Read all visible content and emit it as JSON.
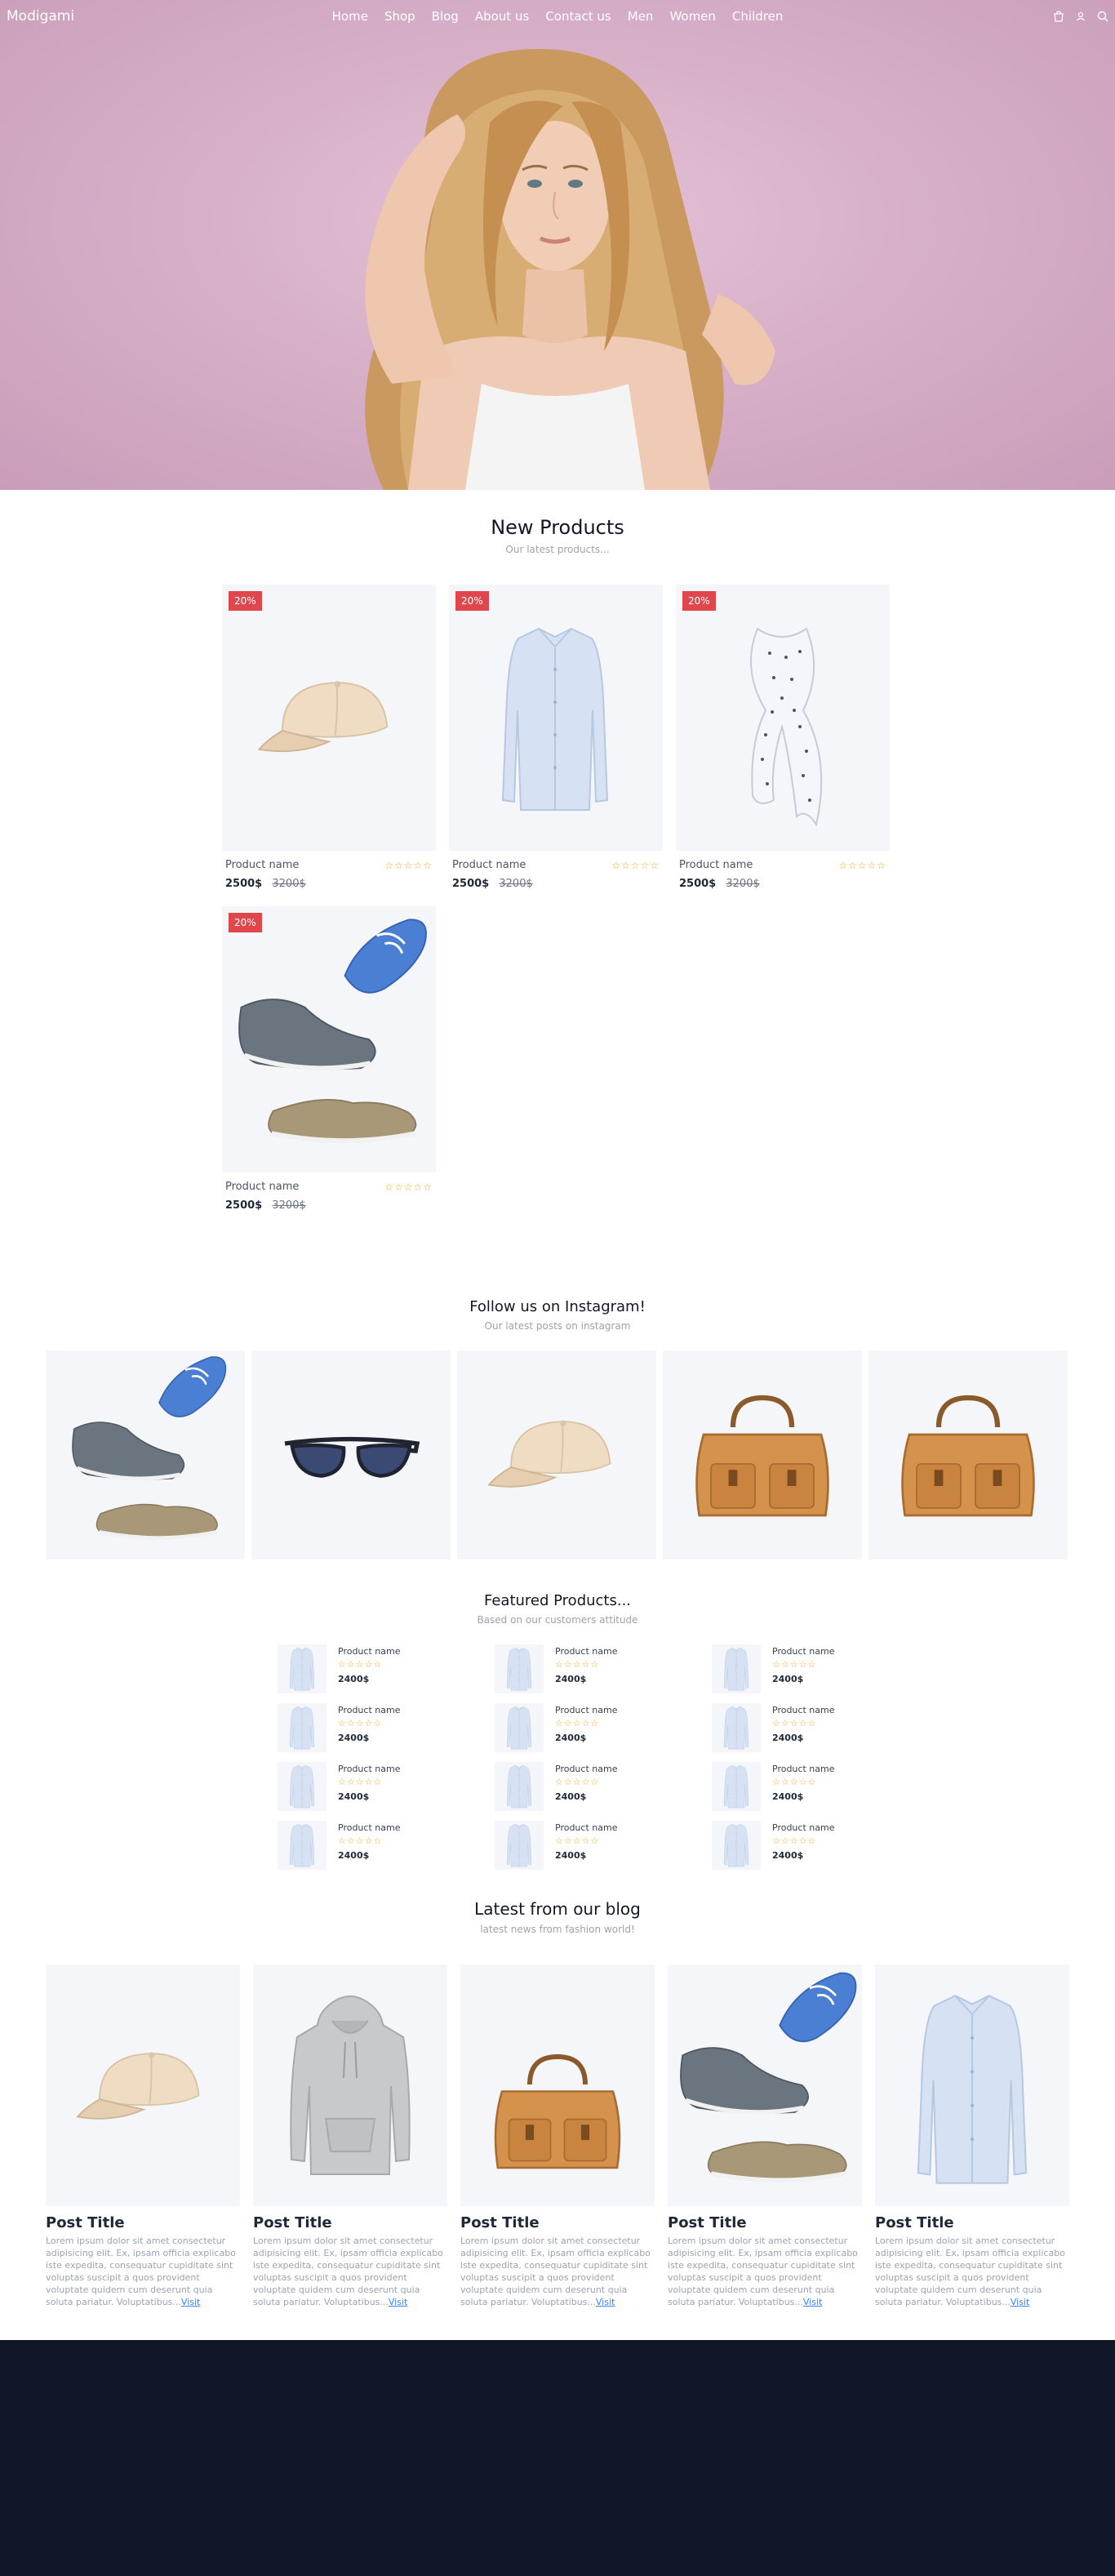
{
  "nav": {
    "logo": "Modigami",
    "links": [
      "Home",
      "Shop",
      "Blog",
      "About us",
      "Contact us",
      "Men",
      "Women",
      "Children"
    ],
    "icons": [
      "bag-icon",
      "user-icon",
      "search-icon"
    ]
  },
  "new_products": {
    "title": "New Products",
    "subtitle": "Our latest products...",
    "items": [
      {
        "badge": "20%",
        "name": "Product name",
        "stars": "☆☆☆☆☆",
        "price": "2500$",
        "old_price": "3200$",
        "image": "cap"
      },
      {
        "badge": "20%",
        "name": "Product name",
        "stars": "☆☆☆☆☆",
        "price": "2500$",
        "old_price": "3200$",
        "image": "shirt"
      },
      {
        "badge": "20%",
        "name": "Product name",
        "stars": "☆☆☆☆☆",
        "price": "2500$",
        "old_price": "3200$",
        "image": "scarf"
      },
      {
        "badge": "20%",
        "name": "Product name",
        "stars": "☆☆☆☆☆",
        "price": "2500$",
        "old_price": "3200$",
        "image": "shoes"
      }
    ]
  },
  "instagram": {
    "title": "Follow us on Instagram!",
    "subtitle": "Our latest posts on instagram",
    "tiles": [
      "shoes",
      "sunglasses",
      "cap",
      "bag",
      "bag"
    ]
  },
  "featured": {
    "title": "Featured Products...",
    "subtitle": "Based on our customers attitude",
    "items": [
      {
        "name": "Product name",
        "stars": "☆☆☆☆☆",
        "price": "2400$"
      },
      {
        "name": "Product name",
        "stars": "☆☆☆☆☆",
        "price": "2400$"
      },
      {
        "name": "Product name",
        "stars": "☆☆☆☆☆",
        "price": "2400$"
      },
      {
        "name": "Product name",
        "stars": "☆☆☆☆☆",
        "price": "2400$"
      },
      {
        "name": "Product name",
        "stars": "☆☆☆☆☆",
        "price": "2400$"
      },
      {
        "name": "Product name",
        "stars": "☆☆☆☆☆",
        "price": "2400$"
      },
      {
        "name": "Product name",
        "stars": "☆☆☆☆☆",
        "price": "2400$"
      },
      {
        "name": "Product name",
        "stars": "☆☆☆☆☆",
        "price": "2400$"
      },
      {
        "name": "Product name",
        "stars": "☆☆☆☆☆",
        "price": "2400$"
      },
      {
        "name": "Product name",
        "stars": "☆☆☆☆☆",
        "price": "2400$"
      },
      {
        "name": "Product name",
        "stars": "☆☆☆☆☆",
        "price": "2400$"
      },
      {
        "name": "Product name",
        "stars": "☆☆☆☆☆",
        "price": "2400$"
      }
    ]
  },
  "blog": {
    "title": "Latest from our blog",
    "subtitle": "latest news from fashion world!",
    "posts": [
      {
        "title": "Post Title",
        "text": "Lorem ipsum dolor sit amet consectetur adipisicing elit. Ex, ipsam officia explicabo iste expedita, consequatur cupiditate sint voluptas suscipit a quos provident voluptate quidem cum deserunt quia soluta pariatur. Voluptatibus...",
        "link": "Visit",
        "image": "cap"
      },
      {
        "title": "Post Title",
        "text": "Lorem ipsum dolor sit amet consectetur adipisicing elit. Ex, ipsam officia explicabo iste expedita, consequatur cupiditate sint voluptas suscipit a quos provident voluptate quidem cum deserunt quia soluta pariatur. Voluptatibus...",
        "link": "Visit",
        "image": "hoodie"
      },
      {
        "title": "Post Title",
        "text": "Lorem ipsum dolor sit amet consectetur adipisicing elit. Ex, ipsam officia explicabo iste expedita, consequatur cupiditate sint voluptas suscipit a quos provident voluptate quidem cum deserunt quia soluta pariatur. Voluptatibus...",
        "link": "Visit",
        "image": "bag"
      },
      {
        "title": "Post Title",
        "text": "Lorem ipsum dolor sit amet consectetur adipisicing elit. Ex, ipsam officia explicabo iste expedita, consequatur cupiditate sint voluptas suscipit a quos provident voluptate quidem cum deserunt quia soluta pariatur. Voluptatibus...",
        "link": "Visit",
        "image": "shoes"
      },
      {
        "title": "Post Title",
        "text": "Lorem ipsum dolor sit amet consectetur adipisicing elit. Ex, ipsam officia explicabo iste expedita, consequatur cupiditate sint voluptas suscipit a quos provident voluptate quidem cum deserunt quia soluta pariatur. Voluptatibus...",
        "link": "Visit",
        "image": "shirt"
      }
    ]
  },
  "colors": {
    "hero_bg": "#d7b0c8",
    "badge": "#e0474c",
    "star": "#f5a623",
    "link": "#3b82f6",
    "footer": "#111628"
  }
}
